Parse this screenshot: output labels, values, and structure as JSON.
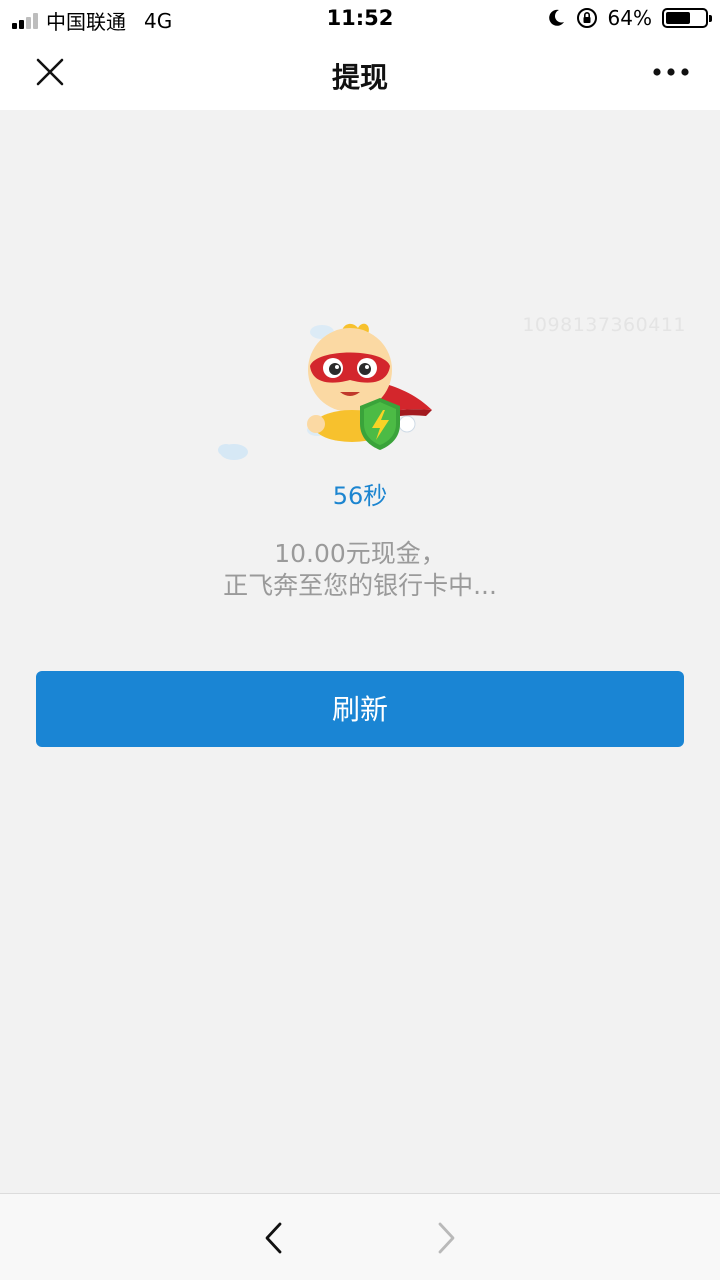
{
  "status_bar": {
    "carrier": "中国联通",
    "network": "4G",
    "time": "11:52",
    "battery_text": "64%",
    "battery_level": 0.64,
    "icons": [
      "signal-icon",
      "moon-icon",
      "orientation-lock-icon",
      "battery-icon"
    ]
  },
  "nav": {
    "title": "提现",
    "close_icon": "close-icon",
    "more_icon": "more-icon"
  },
  "content": {
    "watermark": "1098137360411",
    "countdown": "56秒",
    "message_line1": "10.00元现金，",
    "message_line2": "正飞奔至您的银行卡中...",
    "mascot": "mascot-hero-icon"
  },
  "actions": {
    "refresh_label": "刷新"
  },
  "bottom_bar": {
    "back_icon": "chevron-left-icon",
    "forward_icon": "chevron-right-icon"
  },
  "colors": {
    "accent": "#1a85d4",
    "countdown": "#1c85d0",
    "message_text": "#9a9a9a",
    "background": "#f2f2f2"
  }
}
